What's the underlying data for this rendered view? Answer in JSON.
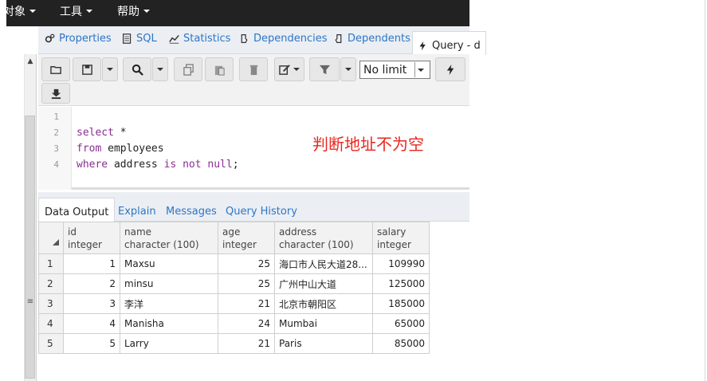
{
  "menubar": {
    "items": [
      {
        "label": "对象"
      },
      {
        "label": "工具"
      },
      {
        "label": "帮助"
      }
    ]
  },
  "tabs": [
    {
      "label": "Properties",
      "icon": "properties-icon"
    },
    {
      "label": "SQL",
      "icon": "sql-icon"
    },
    {
      "label": "Statistics",
      "icon": "statistics-icon"
    },
    {
      "label": "Dependencies",
      "icon": "dependencies-icon"
    },
    {
      "label": "Dependents",
      "icon": "dependents-icon"
    },
    {
      "label": "Query - d",
      "icon": "lightning-icon",
      "active": true
    }
  ],
  "toolbar": {
    "limit_value": "No limit"
  },
  "editor": {
    "line_numbers": [
      "1",
      "2",
      "3",
      "4"
    ],
    "lines": [
      {
        "kw": "",
        "rest": ""
      },
      {
        "kw": "select",
        "rest": " *"
      },
      {
        "kw": "from",
        "rest": " employees"
      },
      {
        "kw": "where",
        "rest": " address ",
        "kw2": "is not null",
        "rest2": ";"
      }
    ]
  },
  "annotation": "判断地址不为空",
  "results": {
    "tabs": [
      {
        "label": "Data Output",
        "active": true
      },
      {
        "label": "Explain"
      },
      {
        "label": "Messages"
      },
      {
        "label": "Query History"
      }
    ],
    "columns": [
      {
        "name": "id",
        "type": "integer"
      },
      {
        "name": "name",
        "type": "character (100)"
      },
      {
        "name": "age",
        "type": "integer"
      },
      {
        "name": "address",
        "type": "character (100)"
      },
      {
        "name": "salary",
        "type": "integer"
      }
    ],
    "rows": [
      {
        "n": "1",
        "id": "1",
        "name": "Maxsu",
        "age": "25",
        "address": "海口市人民大道28...",
        "salary": "109990"
      },
      {
        "n": "2",
        "id": "2",
        "name": "minsu",
        "age": "25",
        "address": "广州中山大道",
        "salary": "125000"
      },
      {
        "n": "3",
        "id": "3",
        "name": "李洋",
        "age": "21",
        "address": "北京市朝阳区",
        "salary": "185000"
      },
      {
        "n": "4",
        "id": "4",
        "name": "Manisha",
        "age": "24",
        "address": "Mumbai",
        "salary": "65000"
      },
      {
        "n": "5",
        "id": "5",
        "name": "Larry",
        "age": "21",
        "address": "Paris",
        "salary": "85000"
      }
    ]
  },
  "colors": {
    "menubar_bg": "#222222",
    "link_blue": "#2c76c7",
    "keyword_purple": "#8a2d92",
    "annotation_red": "#e8271f"
  }
}
